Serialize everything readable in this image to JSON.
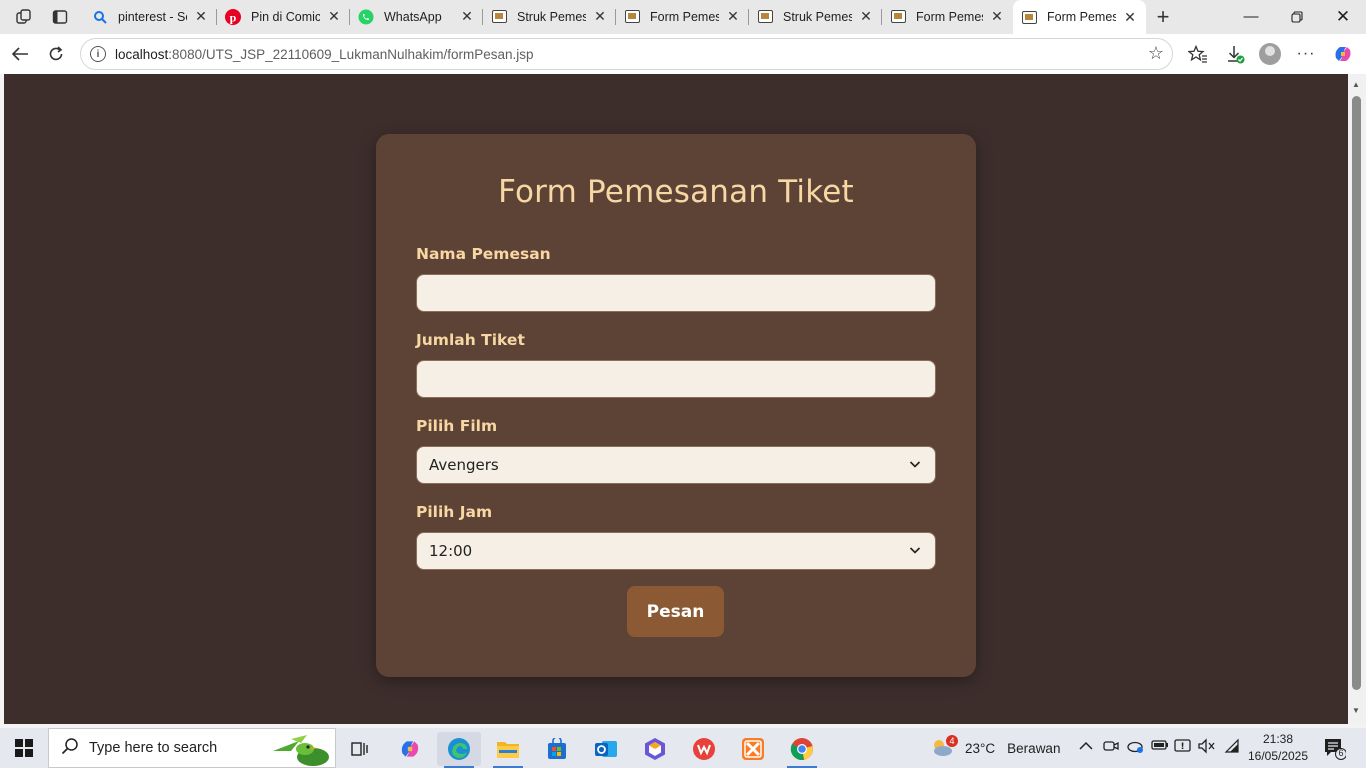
{
  "browser": {
    "tabs": [
      {
        "title": "pinterest - Se",
        "icon": "search-favicon"
      },
      {
        "title": "Pin di Comic",
        "icon": "pinterest-favicon"
      },
      {
        "title": "WhatsApp",
        "icon": "whatsapp-favicon"
      },
      {
        "title": "Struk Pemesa",
        "icon": "page-favicon"
      },
      {
        "title": "Form Pemesa",
        "icon": "page-favicon"
      },
      {
        "title": "Struk Pemesa",
        "icon": "page-favicon"
      },
      {
        "title": "Form Pemesa",
        "icon": "page-favicon"
      },
      {
        "title": "Form Pemesa",
        "icon": "page-favicon",
        "active": true
      }
    ],
    "url_host": "localhost",
    "url_rest": ":8080/UTS_JSP_22110609_LukmanNulhakim/formPesan.jsp"
  },
  "form": {
    "title": "Form Pemesanan Tiket",
    "nama_label": "Nama Pemesan",
    "nama_value": "",
    "jumlah_label": "Jumlah Tiket",
    "jumlah_value": "",
    "film_label": "Pilih Film",
    "film_selected": "Avengers",
    "jam_label": "Pilih Jam",
    "jam_selected": "12:00",
    "submit_label": "Pesan"
  },
  "taskbar": {
    "search_placeholder": "Type here to search",
    "weather_temp": "23°C",
    "weather_desc": "Berawan",
    "weather_badge": "4",
    "time": "21:38",
    "date": "16/05/2025",
    "notification_count": "6"
  },
  "colors": {
    "page_bg": "#3d2e2c",
    "card_bg": "#5d4236",
    "accent_text": "#f7d7a3",
    "button_bg": "#8b5a34"
  }
}
